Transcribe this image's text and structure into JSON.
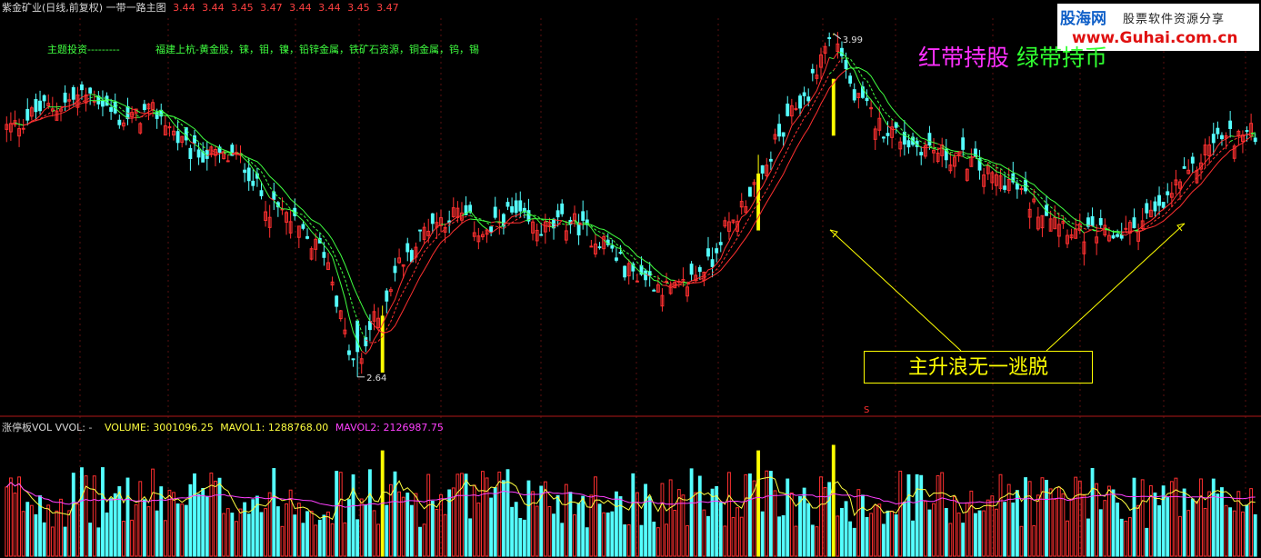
{
  "header": {
    "title": "紫金矿业(日线,前复权) 一带一路主图",
    "quotes": [
      "3.44",
      "3.44",
      "3.45",
      "3.47",
      "3.44",
      "3.44",
      "3.45",
      "3.47"
    ]
  },
  "theme": {
    "label": "主题投资---------",
    "text": "福建上杭-黄金股，铼，钼，镍，铅锌金属，铁矿石资源，铜金属，钨，锡"
  },
  "logo": {
    "brand": "股海网",
    "tagline": "股票软件资源分享",
    "url": "www.Guhai.com.cn"
  },
  "slogan": {
    "red_part": "红带持股",
    "green_part": "绿带持币"
  },
  "callout": "主升浪无一逃脱",
  "volume_header": {
    "name": "涨停板VOL VVOL: -",
    "volume": "VOLUME: 3001096.25",
    "mavol1": "MAVOL1: 1288768.00",
    "mavol2": "MAVOL2: 2126987.75"
  },
  "marker": "S",
  "colors": {
    "background": "#000000",
    "up_candle": "#ff3030",
    "down_candle": "#54ffff",
    "limit_up": "#ffff00",
    "band_red": "#ff3030",
    "band_green": "#40ff40",
    "mavol1": "#ffff40",
    "mavol2": "#ff40ff"
  },
  "chart_data": [
    {
      "type": "candlestick",
      "title": "紫金矿业(日线,前复权) 一带一路主图",
      "annotations": [
        {
          "text": "3.99",
          "x": 198,
          "y": 3.99
        },
        {
          "text": "2.64",
          "x": 84,
          "y": 2.64
        }
      ],
      "ylim": [
        2.55,
        4.05
      ],
      "n_bars": 300,
      "band": "color of moving-average band: red = hold stock, green = hold cash",
      "path_keypoints": {
        "x": [
          0,
          10,
          20,
          28,
          35,
          45,
          55,
          64,
          75,
          84,
          88,
          95,
          102,
          108,
          115,
          120,
          128,
          135,
          142,
          150,
          160,
          168,
          172,
          180,
          185,
          190,
          198,
          204,
          210,
          218,
          228,
          238,
          248,
          258,
          266,
          275,
          282,
          290,
          300
        ],
        "y": [
          3.62,
          3.7,
          3.75,
          3.65,
          3.68,
          3.52,
          3.5,
          3.3,
          3.15,
          2.68,
          2.86,
          3.1,
          3.25,
          3.28,
          3.2,
          3.28,
          3.22,
          3.25,
          3.18,
          3.05,
          2.98,
          3.08,
          3.22,
          3.4,
          3.58,
          3.72,
          3.98,
          3.72,
          3.62,
          3.55,
          3.5,
          3.42,
          3.3,
          3.2,
          3.2,
          3.28,
          3.42,
          3.58,
          3.6
        ]
      },
      "limit_up_bars": [
        90,
        180,
        198
      ]
    },
    {
      "type": "bar",
      "title": "涨停板VOL",
      "series": [
        {
          "name": "VOLUME",
          "latest": 3001096.25
        },
        {
          "name": "MAVOL1",
          "latest": 1288768.0
        },
        {
          "name": "MAVOL2",
          "latest": 2126987.75
        }
      ]
    }
  ]
}
